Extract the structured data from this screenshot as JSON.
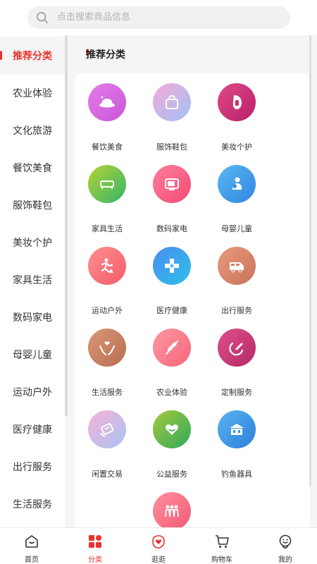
{
  "search": {
    "placeholder": "点击搜索商品信息"
  },
  "sidebar": {
    "items": [
      {
        "label": "推荐分类",
        "active": true
      },
      {
        "label": "农业体验"
      },
      {
        "label": "文化旅游"
      },
      {
        "label": "餐饮美食"
      },
      {
        "label": "服饰鞋包"
      },
      {
        "label": "美妆个护"
      },
      {
        "label": "家具生活"
      },
      {
        "label": "数码家电"
      },
      {
        "label": "母婴儿童"
      },
      {
        "label": "运动户外"
      },
      {
        "label": "医疗健康"
      },
      {
        "label": "出行服务"
      },
      {
        "label": "生活服务"
      }
    ]
  },
  "main": {
    "section_title": "推荐分类",
    "categories": [
      {
        "label": "餐饮美食",
        "icon": "food-plate-icon"
      },
      {
        "label": "服饰鞋包",
        "icon": "handbag-icon"
      },
      {
        "label": "美妆个护",
        "icon": "face-makeup-icon"
      },
      {
        "label": "家具生活",
        "icon": "sofa-icon"
      },
      {
        "label": "数码家电",
        "icon": "tv-icon"
      },
      {
        "label": "母婴儿童",
        "icon": "mother-baby-icon"
      },
      {
        "label": "运动户外",
        "icon": "running-icon"
      },
      {
        "label": "医疗健康",
        "icon": "medical-cross-icon"
      },
      {
        "label": "出行服务",
        "icon": "van-icon"
      },
      {
        "label": "生活服务",
        "icon": "hands-heart-icon"
      },
      {
        "label": "农业体验",
        "icon": "wheat-icon"
      },
      {
        "label": "定制服务",
        "icon": "custom-pen-icon"
      },
      {
        "label": "闲置交易",
        "icon": "tag-exchange-icon"
      },
      {
        "label": "公益服务",
        "icon": "charity-heart-icon"
      },
      {
        "label": "钓鱼器具",
        "icon": "fishing-house-icon"
      },
      {
        "label": "",
        "icon": "people-group-icon"
      }
    ]
  },
  "tabbar": {
    "items": [
      {
        "label": "首页",
        "icon": "home-icon"
      },
      {
        "label": "分类",
        "icon": "category-grid-icon",
        "active": true
      },
      {
        "label": "逛逛",
        "icon": "browse-heart-icon"
      },
      {
        "label": "购物车",
        "icon": "cart-icon"
      },
      {
        "label": "我的",
        "icon": "profile-smile-icon"
      }
    ]
  },
  "colors": {
    "accent": "#e8322e",
    "text": "#333333",
    "placeholder": "#b3b3b3"
  }
}
